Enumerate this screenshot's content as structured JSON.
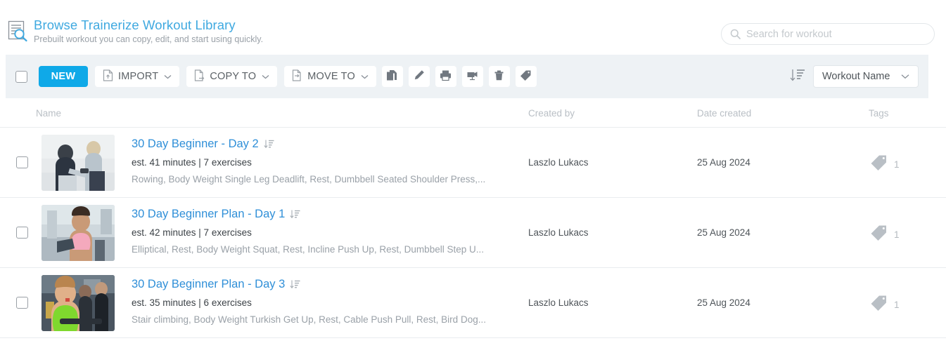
{
  "header": {
    "icon": "browse-library-icon",
    "title": "Browse Trainerize Workout Library",
    "subtitle": "Prebuilt workout you can copy, edit, and start using quickly."
  },
  "search": {
    "icon": "search-icon",
    "placeholder": "Search for workout",
    "value": ""
  },
  "toolbar": {
    "select_all_checked": false,
    "new_label": "NEW",
    "dropdowns": [
      {
        "label": "IMPORT",
        "icon": "import-file-icon",
        "caret": "chevron-down-icon"
      },
      {
        "label": "COPY TO",
        "icon": "copy-file-icon",
        "caret": "chevron-down-icon"
      },
      {
        "label": "MOVE TO",
        "icon": "move-file-icon",
        "caret": "chevron-down-icon"
      }
    ],
    "icon_buttons": [
      {
        "name": "duplicate-icon"
      },
      {
        "name": "edit-pencil-icon"
      },
      {
        "name": "print-icon"
      },
      {
        "name": "present-icon"
      },
      {
        "name": "delete-trash-icon"
      },
      {
        "name": "tag-icon"
      }
    ],
    "sort_icon": "sort-descending-icon",
    "sort_value": "Workout Name",
    "sort_caret": "chevron-down-icon"
  },
  "table": {
    "columns": [
      "Name",
      "Created by",
      "Date created",
      "Tags"
    ],
    "rows": [
      {
        "title": "30 Day Beginner - Day 2",
        "title_icon": "workout-list-icon",
        "meta": "est. 41 minutes | 7 exercises",
        "exercises": "Rowing, Body Weight Single Leg Deadlift, Rest, Dumbbell Seated Shoulder Press,...",
        "created_by": "Laszlo Lukacs",
        "date_created": "25 Aug 2024",
        "tag_icon": "tag-icon",
        "tag_count": "1",
        "checked": false
      },
      {
        "title": "30 Day Beginner Plan - Day 1",
        "title_icon": "workout-list-icon",
        "meta": "est. 42 minutes | 7 exercises",
        "exercises": "Elliptical, Rest, Body Weight Squat, Rest, Incline Push Up, Rest, Dumbbell Step U...",
        "created_by": "Laszlo Lukacs",
        "date_created": "25 Aug 2024",
        "tag_icon": "tag-icon",
        "tag_count": "1",
        "checked": false
      },
      {
        "title": "30 Day Beginner Plan - Day 3",
        "title_icon": "workout-list-icon",
        "meta": "est. 35 minutes | 6 exercises",
        "exercises": "Stair climbing, Body Weight Turkish Get Up, Rest, Cable Push Pull, Rest, Bird Dog...",
        "created_by": "Laszlo Lukacs",
        "date_created": "25 Aug 2024",
        "tag_icon": "tag-icon",
        "tag_count": "1",
        "checked": false
      }
    ]
  },
  "colors": {
    "accent_blue": "#0FA9E8",
    "link_blue": "#2F8FD8",
    "title_blue": "#3FA9E0",
    "toolbar_bg": "#eef2f5",
    "muted_text": "#9aa1a8"
  }
}
